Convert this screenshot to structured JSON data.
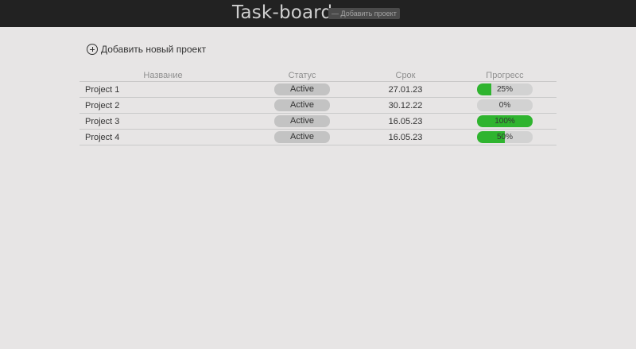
{
  "header": {
    "title": "Task-board",
    "add_button_label": "— Добавить проект"
  },
  "main": {
    "add_project_label": "Добавить новый проект"
  },
  "table": {
    "columns": [
      "Название",
      "Статус",
      "Срок",
      "Прогресс"
    ],
    "rows": [
      {
        "name": "Project 1",
        "status": "Active",
        "deadline": "27.01.23",
        "progress": 25,
        "progress_label": "25%"
      },
      {
        "name": "Project 2",
        "status": "Active",
        "deadline": "30.12.22",
        "progress": 0,
        "progress_label": "0%"
      },
      {
        "name": "Project 3",
        "status": "Active",
        "deadline": "16.05.23",
        "progress": 100,
        "progress_label": "100%"
      },
      {
        "name": "Project 4",
        "status": "Active",
        "deadline": "16.05.23",
        "progress": 50,
        "progress_label": "50%"
      }
    ]
  },
  "colors": {
    "topbar": "#222222",
    "background": "#e7e5e5",
    "progress_fill": "#2fb42f",
    "status_pill": "#c3c3c3"
  }
}
